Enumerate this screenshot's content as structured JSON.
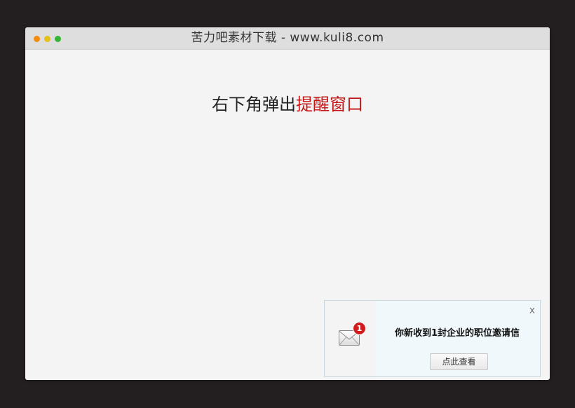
{
  "window": {
    "title": "苦力吧素材下载 - www.kuli8.com",
    "controls": [
      "close",
      "minimize",
      "maximize"
    ]
  },
  "main": {
    "heading_plain": "右下角弹出",
    "heading_highlight": "提醒窗口",
    "highlight_color": "#c51717"
  },
  "popup": {
    "icon": "mail-envelope-icon",
    "badge_count": "1",
    "close_label": "x",
    "message": "你新收到1封企业的职位邀请信",
    "button_label": "点此查看"
  }
}
